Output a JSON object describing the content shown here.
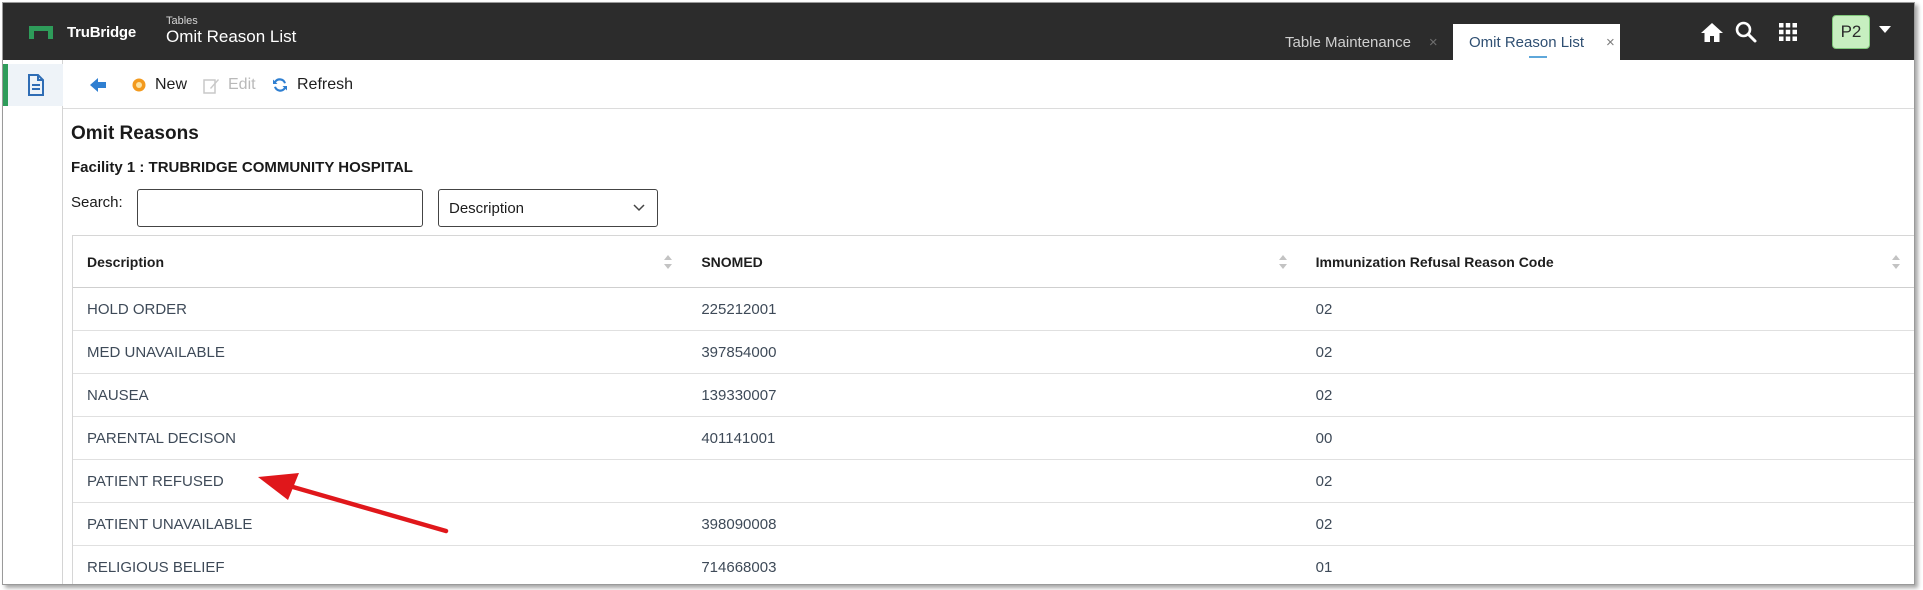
{
  "brand": {
    "name": "TruBridge"
  },
  "app": {
    "subtitle": "Tables",
    "title": "Omit Reason List"
  },
  "tabs": [
    {
      "label": "Table Maintenance",
      "close": "×"
    },
    {
      "label": "Omit Reason List",
      "close": "×"
    }
  ],
  "header_icons": [
    "home-icon",
    "search-icon",
    "apps-grid-icon"
  ],
  "user": {
    "initials": "P2"
  },
  "sidebar": {
    "items": [
      {
        "icon": "document-icon",
        "active": true
      }
    ]
  },
  "toolbar": {
    "new_label": "New",
    "edit_label": "Edit",
    "refresh_label": "Refresh"
  },
  "page": {
    "title": "Omit Reasons",
    "facility": "Facility 1 : TRUBRIDGE COMMUNITY HOSPITAL",
    "search_label": "Search:",
    "search_value": "",
    "search_field_selected": "Description"
  },
  "table": {
    "columns": [
      "Description",
      "SNOMED",
      "Immunization Refusal Reason Code"
    ],
    "rows": [
      [
        "HOLD ORDER",
        "225212001",
        "02"
      ],
      [
        "MED UNAVAILABLE",
        "397854000",
        "02"
      ],
      [
        "NAUSEA",
        "139330007",
        "02"
      ],
      [
        "PARENTAL DECISON",
        "401141001",
        "00"
      ],
      [
        "PATIENT REFUSED",
        "",
        "02"
      ],
      [
        "PATIENT UNAVAILABLE",
        "398090008",
        "02"
      ],
      [
        "RELIGIOUS BELIEF",
        "714668003",
        "01"
      ]
    ]
  },
  "colors": {
    "topbar": "#2c2c2c",
    "brand_green": "#2e9c5a",
    "active_tab_text": "#2f4f72",
    "annotation_arrow": "#e0171b"
  }
}
